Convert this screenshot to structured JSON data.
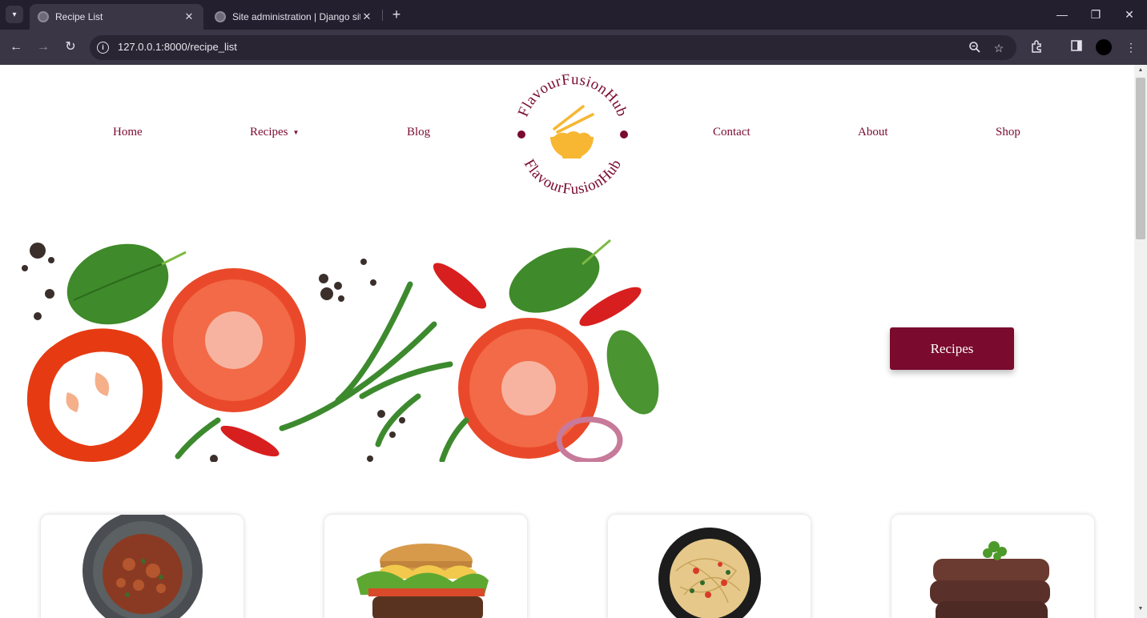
{
  "browser": {
    "tabs": [
      {
        "title": "Recipe List",
        "active": true
      },
      {
        "title": "Site administration | Django site admin",
        "active": false
      }
    ],
    "url": "127.0.0.1:8000/recipe_list"
  },
  "nav": {
    "home": "Home",
    "recipes": "Recipes",
    "blog": "Blog",
    "contact": "Contact",
    "about": "About",
    "shop": "Shop"
  },
  "logo": {
    "text_top": "FlavourFusionHub",
    "text_bottom": "FlavourFusionHub"
  },
  "hero": {
    "button_label": "Recipes"
  },
  "cards": [
    {
      "image": "stew-bowl-image"
    },
    {
      "image": "burger-image"
    },
    {
      "image": "spaghetti-plate-image"
    },
    {
      "image": "steak-stack-image"
    }
  ],
  "colors": {
    "brand": "#7a0a2e",
    "accent": "#f7b733",
    "chrome_dark": "#231f2e",
    "chrome_toolbar": "#3b3646"
  }
}
